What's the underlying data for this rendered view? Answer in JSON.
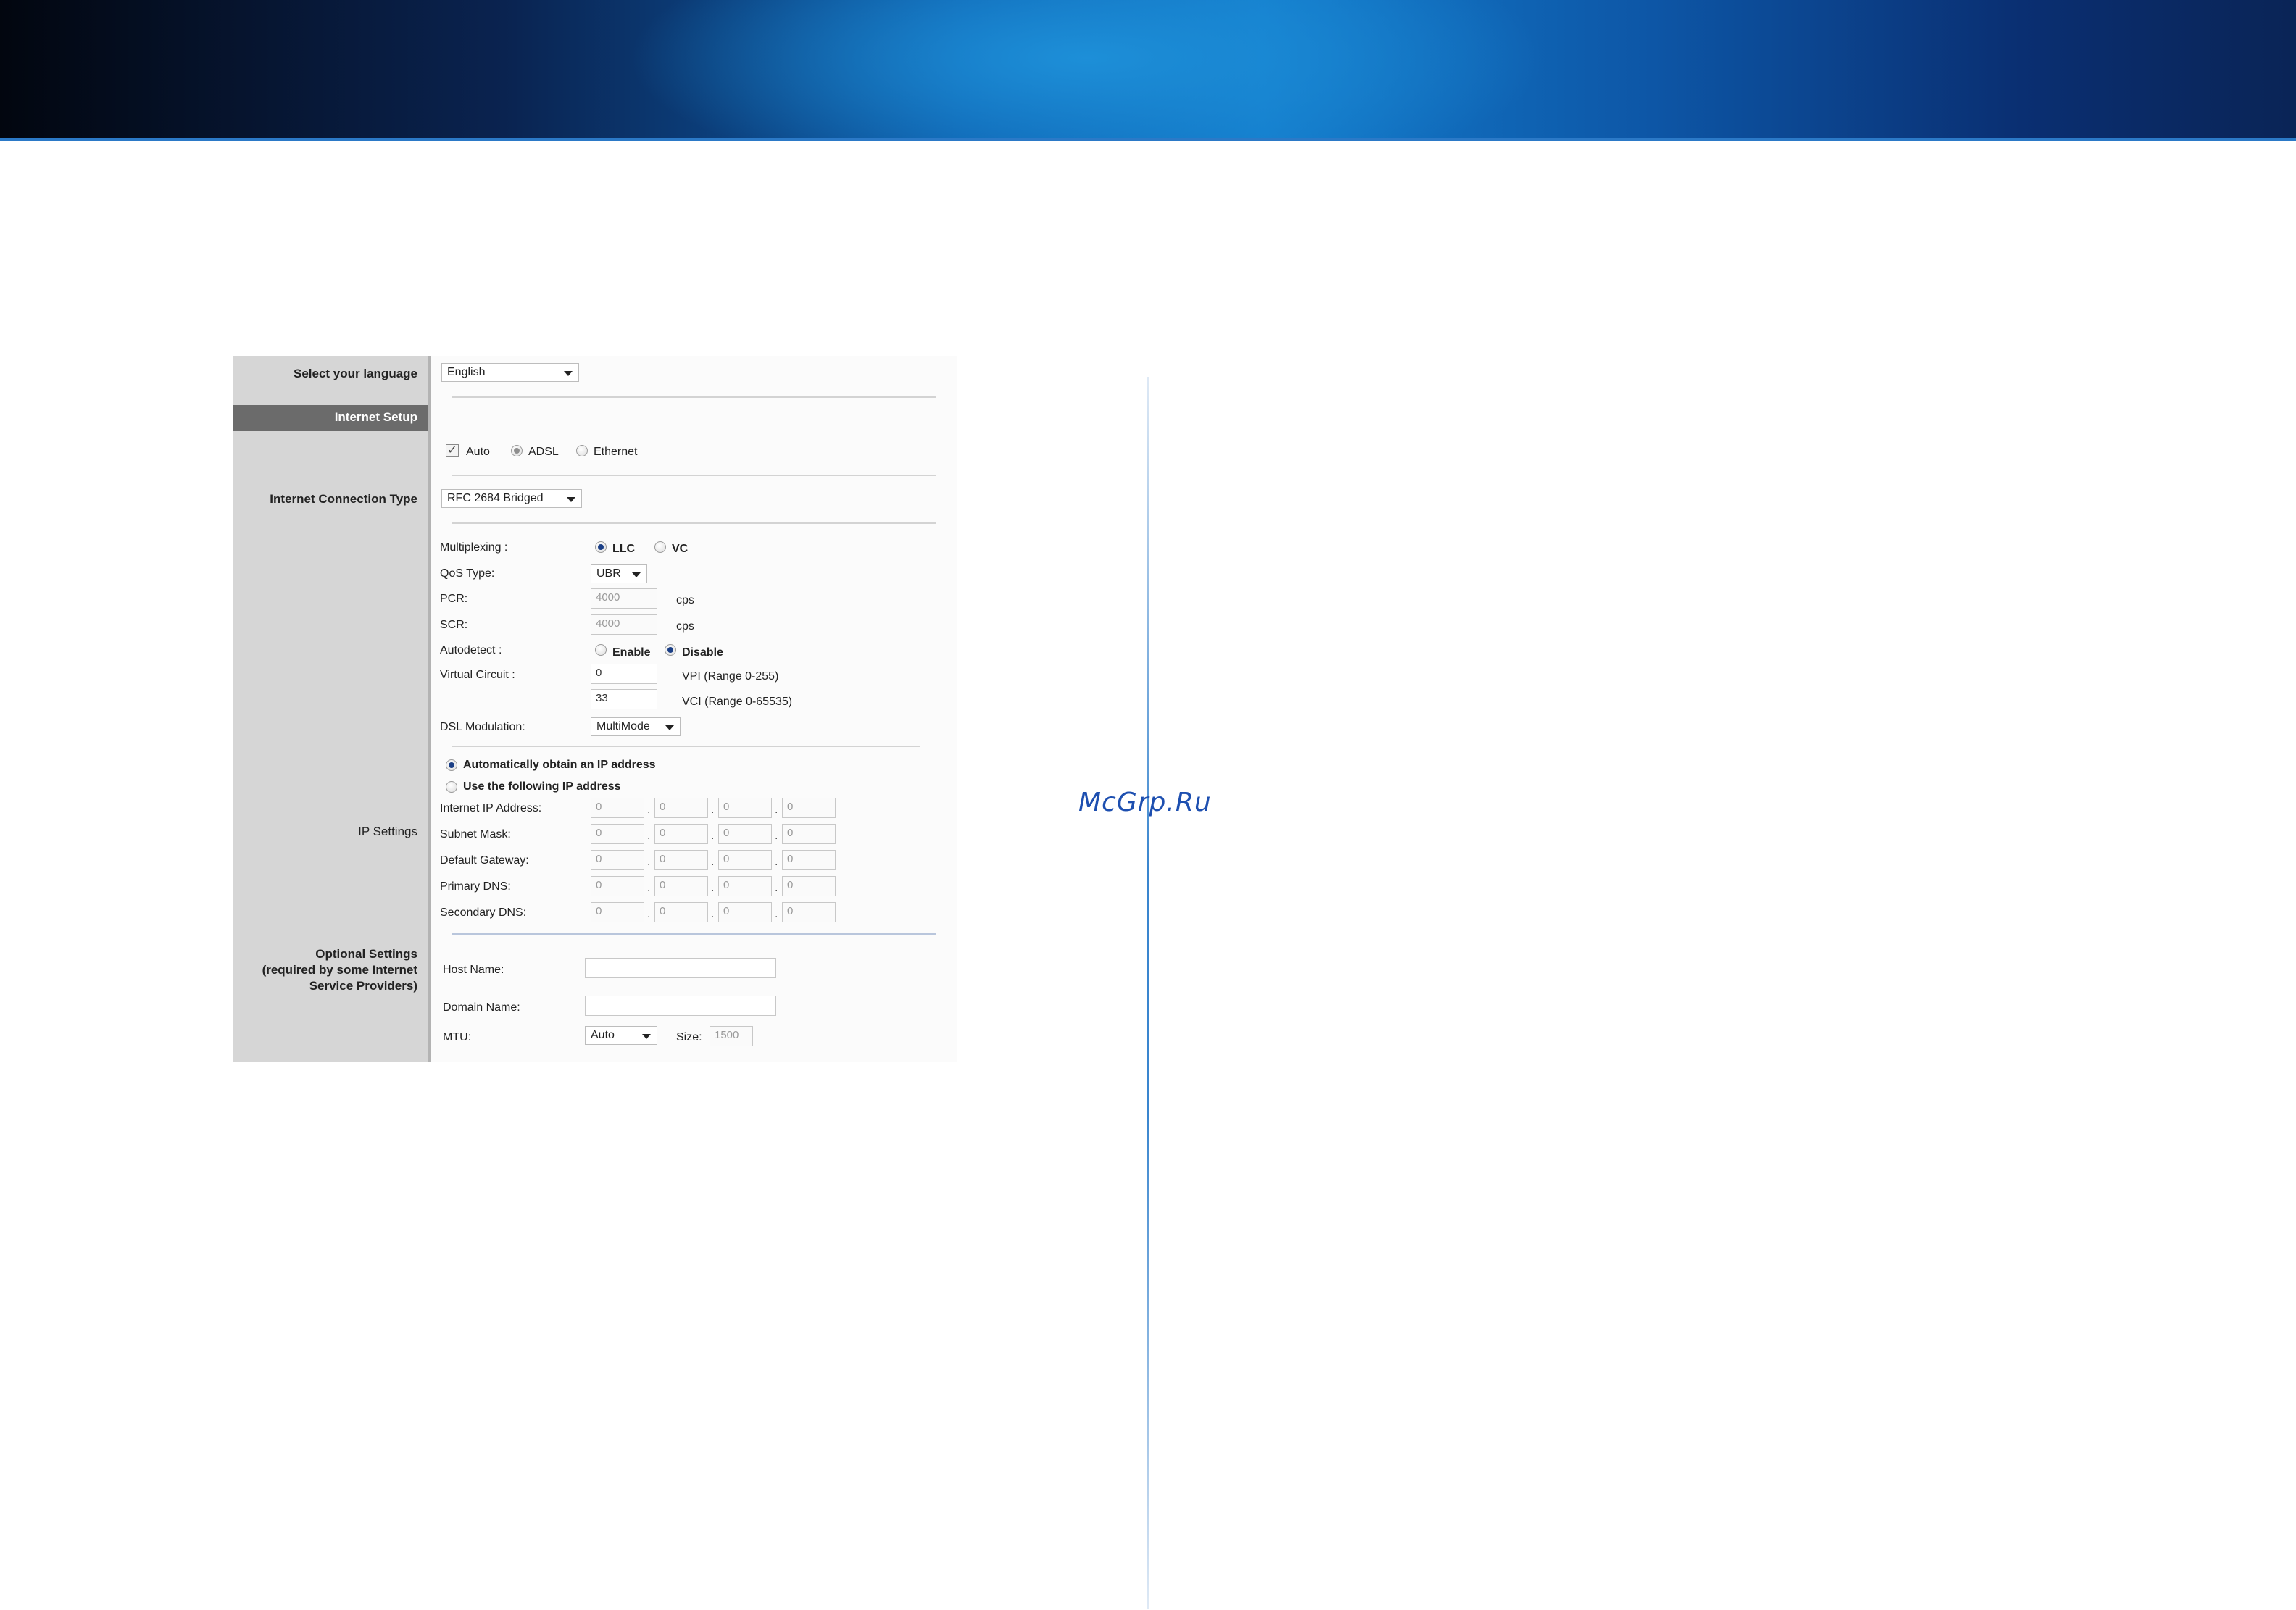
{
  "sidebar": {
    "select_language": "Select your language",
    "section_title": "Internet Setup",
    "connection_type": "Internet Connection Type",
    "ip_settings": "IP Settings",
    "optional_line1": "Optional Settings",
    "optional_line2": "(required by some Internet",
    "optional_line3": "Service Providers)"
  },
  "language": {
    "selected": "English"
  },
  "mode": {
    "auto_label": "Auto",
    "adsl_label": "ADSL",
    "ethernet_label": "Ethernet",
    "auto_checked": true,
    "selected": "ADSL"
  },
  "connection": {
    "selected": "RFC 2684 Bridged"
  },
  "dsl": {
    "multiplexing_label": "Multiplexing :",
    "llc_label": "LLC",
    "vc_label": "VC",
    "multiplexing_selected": "LLC",
    "qos_label": "QoS Type:",
    "qos_value": "UBR",
    "pcr_label": "PCR:",
    "pcr_value": "4000",
    "scr_label": "SCR:",
    "scr_value": "4000",
    "cps_unit": "cps",
    "autodetect_label": "Autodetect :",
    "enable_label": "Enable",
    "disable_label": "Disable",
    "autodetect_selected": "Disable",
    "virtual_circuit_label": "Virtual Circuit :",
    "vpi_value": "0",
    "vpi_range": "VPI (Range 0-255)",
    "vci_value": "33",
    "vci_range": "VCI (Range 0-65535)",
    "modulation_label": "DSL Modulation:",
    "modulation_value": "MultiMode"
  },
  "ip": {
    "auto_label": "Automatically obtain an IP address",
    "manual_label": "Use the following IP address",
    "selected": "auto",
    "rows": [
      {
        "label": "Internet IP Address:",
        "octets": [
          "0",
          "0",
          "0",
          "0"
        ]
      },
      {
        "label": "Subnet Mask:",
        "octets": [
          "0",
          "0",
          "0",
          "0"
        ]
      },
      {
        "label": "Default Gateway:",
        "octets": [
          "0",
          "0",
          "0",
          "0"
        ]
      },
      {
        "label": "Primary DNS:",
        "octets": [
          "0",
          "0",
          "0",
          "0"
        ]
      },
      {
        "label": "Secondary DNS:",
        "octets": [
          "0",
          "0",
          "0",
          "0"
        ]
      }
    ],
    "separator": "."
  },
  "optional": {
    "host_label": "Host Name:",
    "host_value": "",
    "domain_label": "Domain Name:",
    "domain_value": "",
    "mtu_label": "MTU:",
    "mtu_value": "Auto",
    "size_label": "Size:",
    "size_value": "1500"
  },
  "watermark": "McGrp.Ru",
  "colors": {
    "banner_mid": "#137ccc",
    "sidebar_bg": "#d6d6d6",
    "section_bar": "#6b6b6b",
    "radio_selected": "#1b3f86",
    "watermark": "#1d4fb0"
  }
}
